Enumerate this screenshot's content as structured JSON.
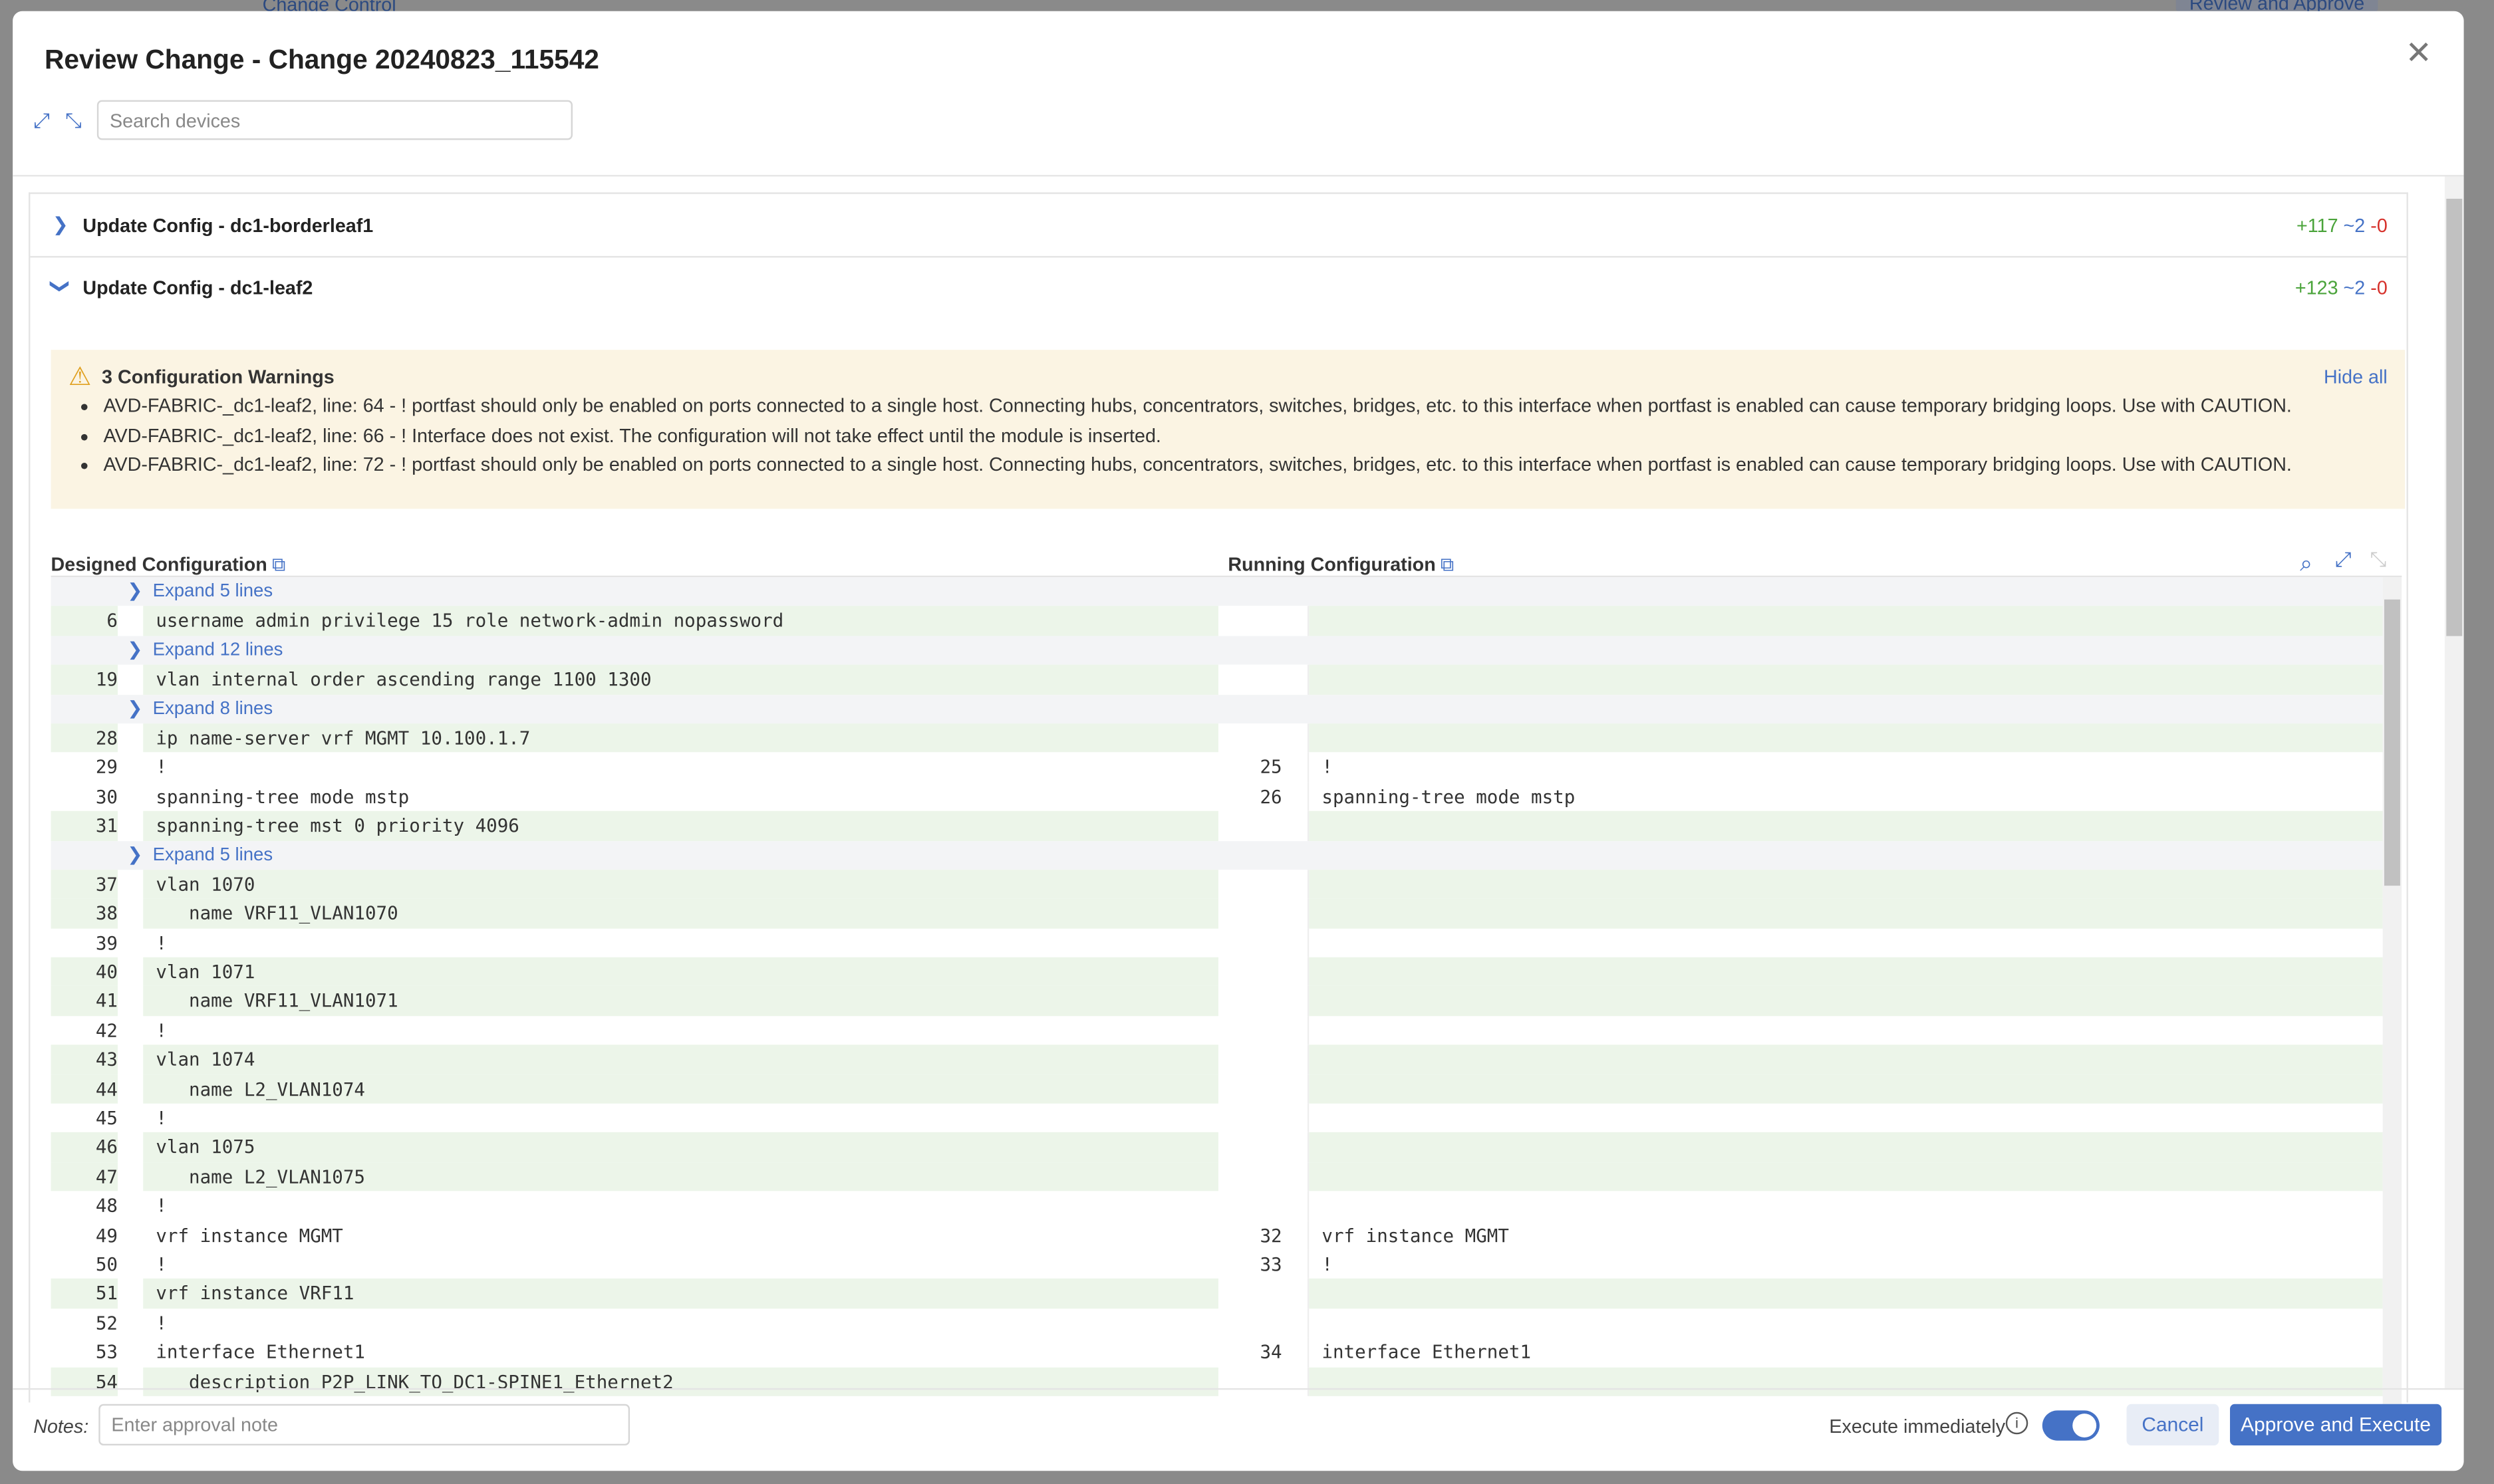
{
  "background": {
    "top_link": "Change Control",
    "top_button": "Review and Approve"
  },
  "modal": {
    "title": "Review Change - Change 20240823_115542",
    "search_placeholder": "Search devices",
    "devices": [
      {
        "name": "Update Config - dc1-borderleaf1",
        "expanded": false,
        "added": "+117",
        "changed": "~2",
        "removed": "-0"
      },
      {
        "name": "Update Config - dc1-leaf2",
        "expanded": true,
        "added": "+123",
        "changed": "~2",
        "removed": "-0"
      }
    ],
    "warnings": {
      "title": "3 Configuration Warnings",
      "hide_all": "Hide all",
      "items": [
        "AVD-FABRIC-_dc1-leaf2, line: 64 - ! portfast should only be enabled on ports connected to a single host. Connecting hubs, concentrators, switches, bridges, etc. to this interface when portfast is enabled can cause temporary bridging loops. Use with CAUTION.",
        "AVD-FABRIC-_dc1-leaf2, line: 66 - ! Interface does not exist. The configuration will not take effect until the module is inserted.",
        "AVD-FABRIC-_dc1-leaf2, line: 72 - ! portfast should only be enabled on ports connected to a single host. Connecting hubs, concentrators, switches, bridges, etc. to this interface when portfast is enabled can cause temporary bridging loops. Use with CAUTION."
      ]
    },
    "designed_label": "Designed Configuration",
    "running_label": "Running Configuration",
    "colors": {
      "accent": "#4572c6",
      "added_bg": "#ecf5e9",
      "warning_bg": "#fbf4e3",
      "add": "#4aa33a",
      "remove": "#d6312b"
    },
    "diff": [
      {
        "type": "expand",
        "label": "Expand 5 lines"
      },
      {
        "type": "add",
        "l": "6",
        "lc": "username admin privilege 15 role network-admin nopassword"
      },
      {
        "type": "expand",
        "label": "Expand 12 lines"
      },
      {
        "type": "add",
        "l": "19",
        "lc": "vlan internal order ascending range 1100 1300"
      },
      {
        "type": "expand",
        "label": "Expand 8 lines"
      },
      {
        "type": "add",
        "l": "28",
        "lc": "ip name-server vrf MGMT 10.100.1.7"
      },
      {
        "type": "same",
        "l": "29",
        "lc": "!",
        "r": "25",
        "rc": "!"
      },
      {
        "type": "same",
        "l": "30",
        "lc": "spanning-tree mode mstp",
        "r": "26",
        "rc": "spanning-tree mode mstp"
      },
      {
        "type": "add",
        "l": "31",
        "lc": "spanning-tree mst 0 priority 4096"
      },
      {
        "type": "expand",
        "label": "Expand 5 lines"
      },
      {
        "type": "add",
        "l": "37",
        "lc": "vlan 1070"
      },
      {
        "type": "add",
        "l": "38",
        "lc": "   name VRF11_VLAN1070"
      },
      {
        "type": "same",
        "l": "39",
        "lc": "!"
      },
      {
        "type": "add",
        "l": "40",
        "lc": "vlan 1071"
      },
      {
        "type": "add",
        "l": "41",
        "lc": "   name VRF11_VLAN1071"
      },
      {
        "type": "same",
        "l": "42",
        "lc": "!"
      },
      {
        "type": "add",
        "l": "43",
        "lc": "vlan 1074"
      },
      {
        "type": "add",
        "l": "44",
        "lc": "   name L2_VLAN1074"
      },
      {
        "type": "same",
        "l": "45",
        "lc": "!"
      },
      {
        "type": "add",
        "l": "46",
        "lc": "vlan 1075"
      },
      {
        "type": "add",
        "l": "47",
        "lc": "   name L2_VLAN1075"
      },
      {
        "type": "same",
        "l": "48",
        "lc": "!"
      },
      {
        "type": "same",
        "l": "49",
        "lc": "vrf instance MGMT",
        "r": "32",
        "rc": "vrf instance MGMT"
      },
      {
        "type": "same",
        "l": "50",
        "lc": "!",
        "r": "33",
        "rc": "!"
      },
      {
        "type": "add",
        "l": "51",
        "lc": "vrf instance VRF11"
      },
      {
        "type": "same",
        "l": "52",
        "lc": "!"
      },
      {
        "type": "same",
        "l": "53",
        "lc": "interface Ethernet1",
        "r": "34",
        "rc": "interface Ethernet1"
      },
      {
        "type": "add",
        "l": "54",
        "lc": "   description P2P_LINK_TO_DC1-SPINE1_Ethernet2"
      }
    ],
    "footer": {
      "notes_label": "Notes:",
      "notes_placeholder": "Enter approval note",
      "execute_label": "Execute immediately",
      "execute_on": true,
      "cancel": "Cancel",
      "approve": "Approve and Execute"
    }
  }
}
